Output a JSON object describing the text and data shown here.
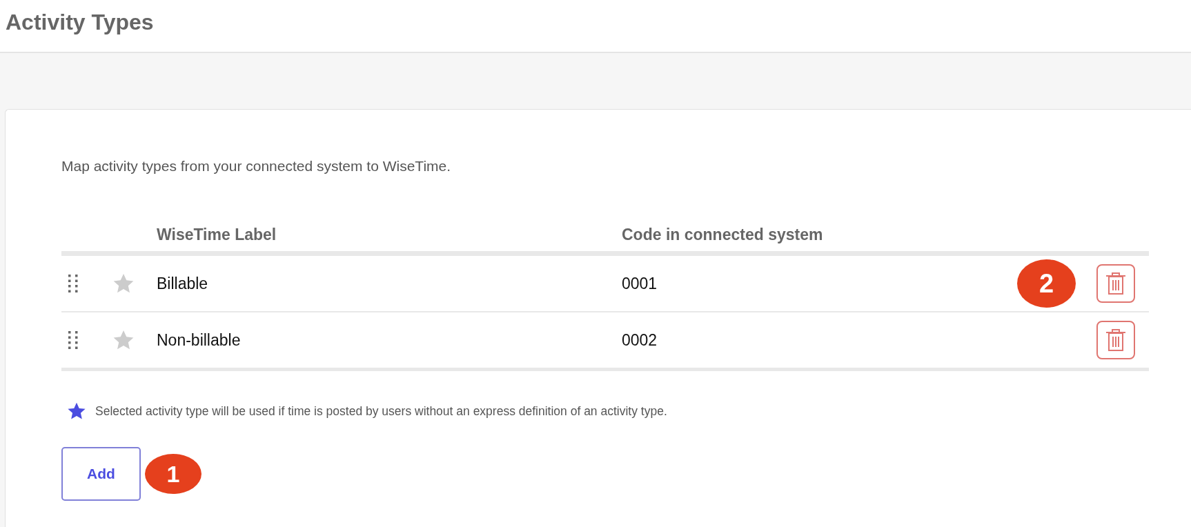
{
  "page": {
    "title": "Activity Types"
  },
  "description": "Map activity types from your connected system to WiseTime.",
  "table": {
    "columns": [
      "WiseTime Label",
      "Code in connected system"
    ],
    "rows": [
      {
        "label": "Billable",
        "code": "0001",
        "selected": false,
        "callout": "2"
      },
      {
        "label": "Non-billable",
        "code": "0002",
        "selected": false
      }
    ]
  },
  "footnote": "Selected activity type will be used if time is posted by users without an express definition of an activity type.",
  "add_button": {
    "label": "Add",
    "callout": "1"
  }
}
